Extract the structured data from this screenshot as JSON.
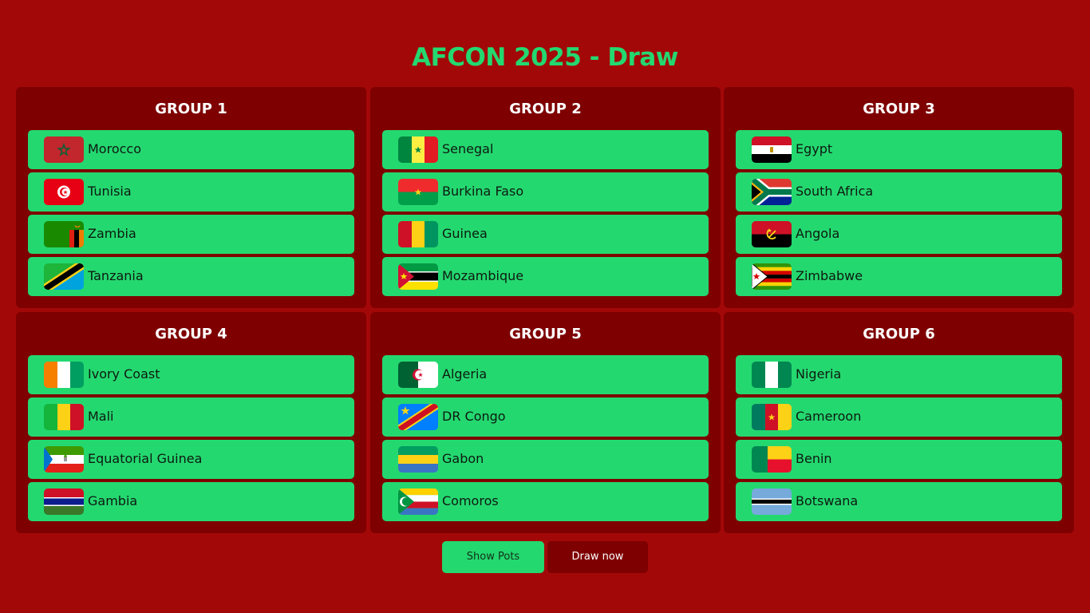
{
  "page": {
    "title": "AFCON 2025 - Draw"
  },
  "groups": [
    {
      "title": "GROUP 1",
      "teams": [
        {
          "name": "Morocco",
          "flag": "morocco-flag-icon"
        },
        {
          "name": "Tunisia",
          "flag": "tunisia-flag-icon"
        },
        {
          "name": "Zambia",
          "flag": "zambia-flag-icon"
        },
        {
          "name": "Tanzania",
          "flag": "tanzania-flag-icon"
        }
      ]
    },
    {
      "title": "GROUP 2",
      "teams": [
        {
          "name": "Senegal",
          "flag": "senegal-flag-icon"
        },
        {
          "name": "Burkina Faso",
          "flag": "burkina-faso-flag-icon"
        },
        {
          "name": "Guinea",
          "flag": "guinea-flag-icon"
        },
        {
          "name": "Mozambique",
          "flag": "mozambique-flag-icon"
        }
      ]
    },
    {
      "title": "GROUP 3",
      "teams": [
        {
          "name": "Egypt",
          "flag": "egypt-flag-icon"
        },
        {
          "name": "South Africa",
          "flag": "south-africa-flag-icon"
        },
        {
          "name": "Angola",
          "flag": "angola-flag-icon"
        },
        {
          "name": "Zimbabwe",
          "flag": "zimbabwe-flag-icon"
        }
      ]
    },
    {
      "title": "GROUP 4",
      "teams": [
        {
          "name": "Ivory Coast",
          "flag": "ivory-coast-flag-icon"
        },
        {
          "name": "Mali",
          "flag": "mali-flag-icon"
        },
        {
          "name": "Equatorial Guinea",
          "flag": "equatorial-guinea-flag-icon"
        },
        {
          "name": "Gambia",
          "flag": "gambia-flag-icon"
        }
      ]
    },
    {
      "title": "GROUP 5",
      "teams": [
        {
          "name": "Algeria",
          "flag": "algeria-flag-icon"
        },
        {
          "name": "DR Congo",
          "flag": "dr-congo-flag-icon"
        },
        {
          "name": "Gabon",
          "flag": "gabon-flag-icon"
        },
        {
          "name": "Comoros",
          "flag": "comoros-flag-icon"
        }
      ]
    },
    {
      "title": "GROUP 6",
      "teams": [
        {
          "name": "Nigeria",
          "flag": "nigeria-flag-icon"
        },
        {
          "name": "Cameroon",
          "flag": "cameroon-flag-icon"
        },
        {
          "name": "Benin",
          "flag": "benin-flag-icon"
        },
        {
          "name": "Botswana",
          "flag": "botswana-flag-icon"
        }
      ]
    }
  ],
  "buttons": {
    "show_pots": "Show Pots",
    "draw_now": "Draw now"
  },
  "colors": {
    "background": "#a30808",
    "panel": "#7e0000",
    "accent": "#24d870"
  }
}
